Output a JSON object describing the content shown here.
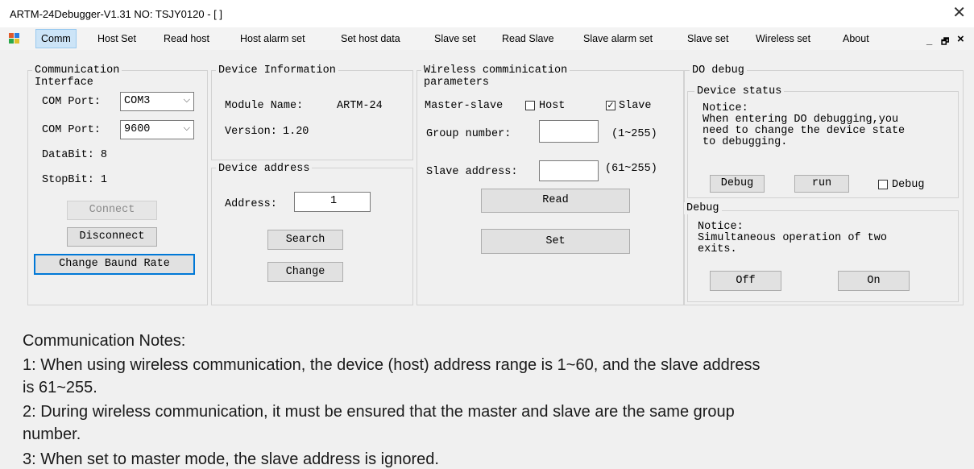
{
  "window": {
    "title": "ARTM-24Debugger-V1.31 NO: TSJY0120 - [ ]",
    "close_glyph": "✕"
  },
  "menu": {
    "items": [
      "Comm",
      "Host Set",
      "Read host",
      "Host alarm set",
      "Set host data",
      "Slave set",
      "Read Slave",
      "Slave alarm set",
      "Slave set",
      "Wireless set",
      "About"
    ],
    "minimize_glyph": "_",
    "restore_glyph": "🗗",
    "close_glyph": "×"
  },
  "comm_interface": {
    "legend": "Communication\nInterface",
    "com_port_label": "COM Port:",
    "com_port_value": "COM3",
    "baud_label": "COM Port:",
    "baud_value": "9600",
    "databit": "DataBit: 8",
    "stopbit": "StopBit: 1",
    "connect": "Connect",
    "disconnect": "Disconnect",
    "change_baud": "Change Baund Rate"
  },
  "device_info": {
    "legend": "Device Information",
    "module_label": "Module Name:",
    "module_value": "ARTM-24",
    "version_label": "Version:",
    "version_value": "1.20"
  },
  "device_address": {
    "legend": "Device address",
    "address_label": "Address:",
    "address_value": "1",
    "search": "Search",
    "change": "Change"
  },
  "wireless": {
    "legend": "Wireless comminication\nparameters",
    "master_slave_label": "Master-slave",
    "host_label": "Host",
    "host_checked": false,
    "slave_label": "Slave",
    "slave_checked": true,
    "group_label": "Group number:",
    "group_value": "",
    "group_range": "(1~255)",
    "slave_addr_label": "Slave address:",
    "slave_addr_value": "",
    "slave_addr_range": "(61~255)",
    "read": "Read",
    "set": "Set"
  },
  "do_debug": {
    "legend": "DO debug",
    "device_status_legend": "Device status",
    "notice1": "Notice:\nWhen entering DO debugging,you\nneed to change the device state\nto debugging.",
    "debug_btn": "Debug",
    "run_btn": "run",
    "debug_cb_label": "Debug",
    "debug_cb_checked": false,
    "debug_legend": "Debug",
    "notice2": "Notice:\nSimultaneous operation of two\nexits.",
    "off": "Off",
    "on": "On"
  },
  "notes": {
    "title": "Communication Notes:",
    "line1": "1: When using wireless communication, the device (host) address range is 1~60, and the slave address",
    "line1b": "is 61~255.",
    "line2": "2: During wireless communication, it must be ensured that the master and slave are the same group",
    "line2b": "number.",
    "line3": "3: When set to master mode, the slave address is ignored."
  }
}
